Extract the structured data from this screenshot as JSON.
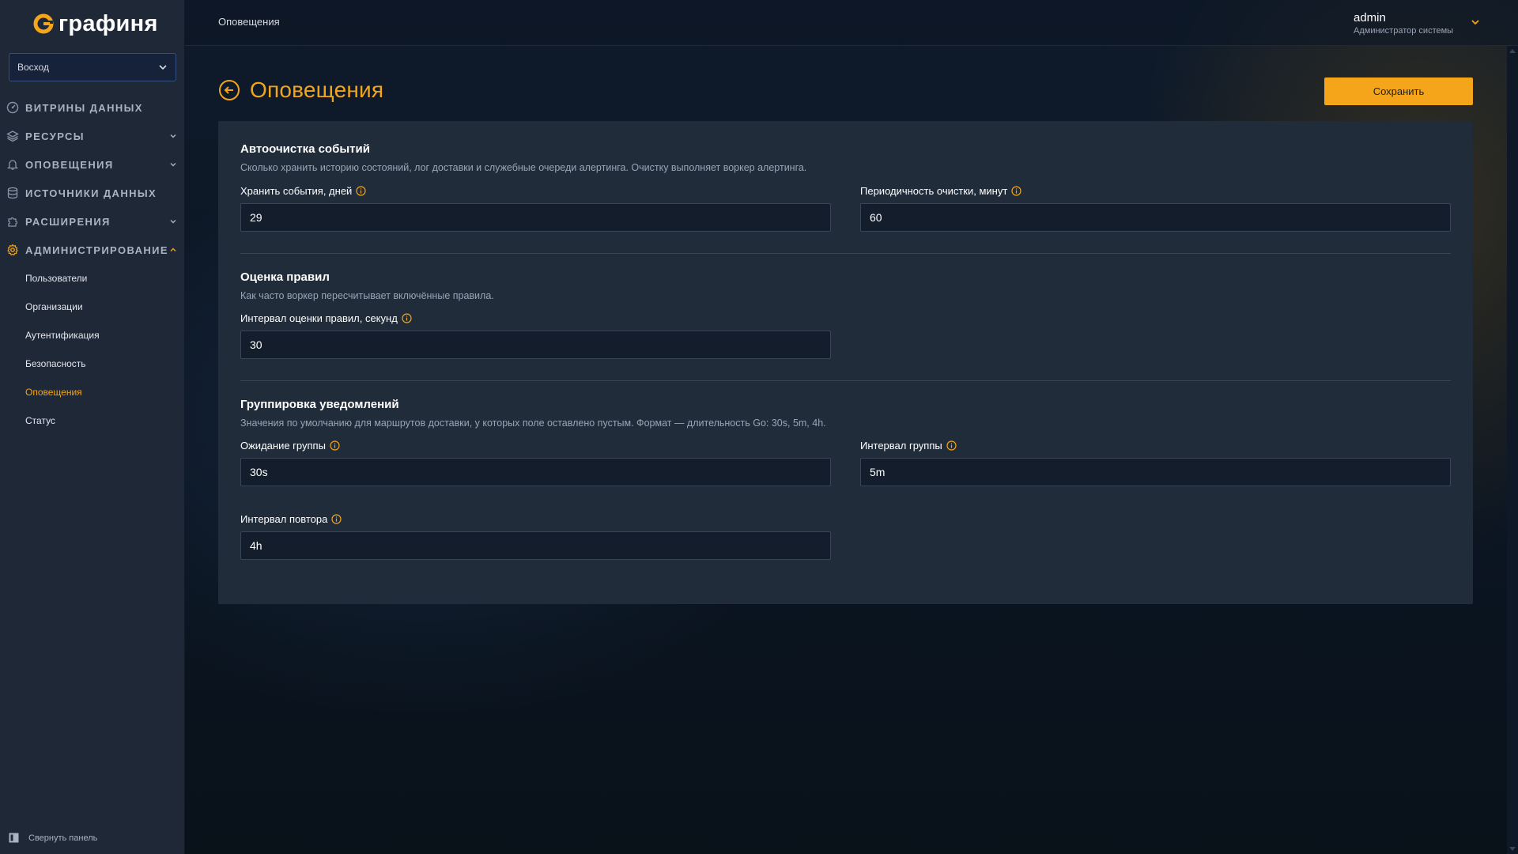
{
  "app": {
    "logo_text": "графиня",
    "brand_color": "#f5a51a"
  },
  "sidebar": {
    "org_select": {
      "value": "Восход"
    },
    "nav": [
      {
        "label": "ВИТРИНЫ ДАННЫХ",
        "icon": "gauge-icon",
        "has_chevron": false
      },
      {
        "label": "РЕСУРСЫ",
        "icon": "layers-icon",
        "has_chevron": true,
        "expanded": false
      },
      {
        "label": "ОПОВЕЩЕНИЯ",
        "icon": "bell-icon",
        "has_chevron": true,
        "expanded": false
      },
      {
        "label": "ИСТОЧНИКИ ДАННЫХ",
        "icon": "database-icon",
        "has_chevron": false
      },
      {
        "label": "РАСШИРЕНИЯ",
        "icon": "puzzle-icon",
        "has_chevron": true,
        "expanded": false
      },
      {
        "label": "АДМИНИСТРИРОВАНИЕ",
        "icon": "gear-icon",
        "has_chevron": true,
        "expanded": true
      }
    ],
    "admin_sub": [
      {
        "label": "Пользователи"
      },
      {
        "label": "Организации"
      },
      {
        "label": "Аутентификация"
      },
      {
        "label": "Безопасность"
      },
      {
        "label": "Оповещения",
        "current": true
      },
      {
        "label": "Статус"
      }
    ],
    "collapse_label": "Свернуть панель"
  },
  "topbar": {
    "breadcrumb": "Оповещения",
    "user": {
      "name": "admin",
      "role": "Администратор системы"
    }
  },
  "page": {
    "title": "Оповещения",
    "save_label": "Сохранить"
  },
  "sections": {
    "cleanup": {
      "title": "Автоочистка событий",
      "description": "Сколько хранить историю состояний, лог доставки и служебные очереди алертинга. Очистку выполняет воркер алертинга.",
      "retention": {
        "label": "Хранить события, дней",
        "value": "29"
      },
      "period": {
        "label": "Периодичность очистки, минут",
        "value": "60"
      }
    },
    "evaluation": {
      "title": "Оценка правил",
      "description": "Как часто воркер пересчитывает включённые правила.",
      "interval": {
        "label": "Интервал оценки правил, секунд",
        "value": "30"
      }
    },
    "grouping": {
      "title": "Группировка уведомлений",
      "description": "Значения по умолчанию для маршрутов доставки, у которых поле оставлено пустым. Формат — длительность Go: 30s, 5m, 4h.",
      "group_wait": {
        "label": "Ожидание группы",
        "value": "30s"
      },
      "group_interval": {
        "label": "Интервал группы",
        "value": "5m"
      },
      "repeat_interval": {
        "label": "Интервал повтора",
        "value": "4h"
      }
    }
  }
}
